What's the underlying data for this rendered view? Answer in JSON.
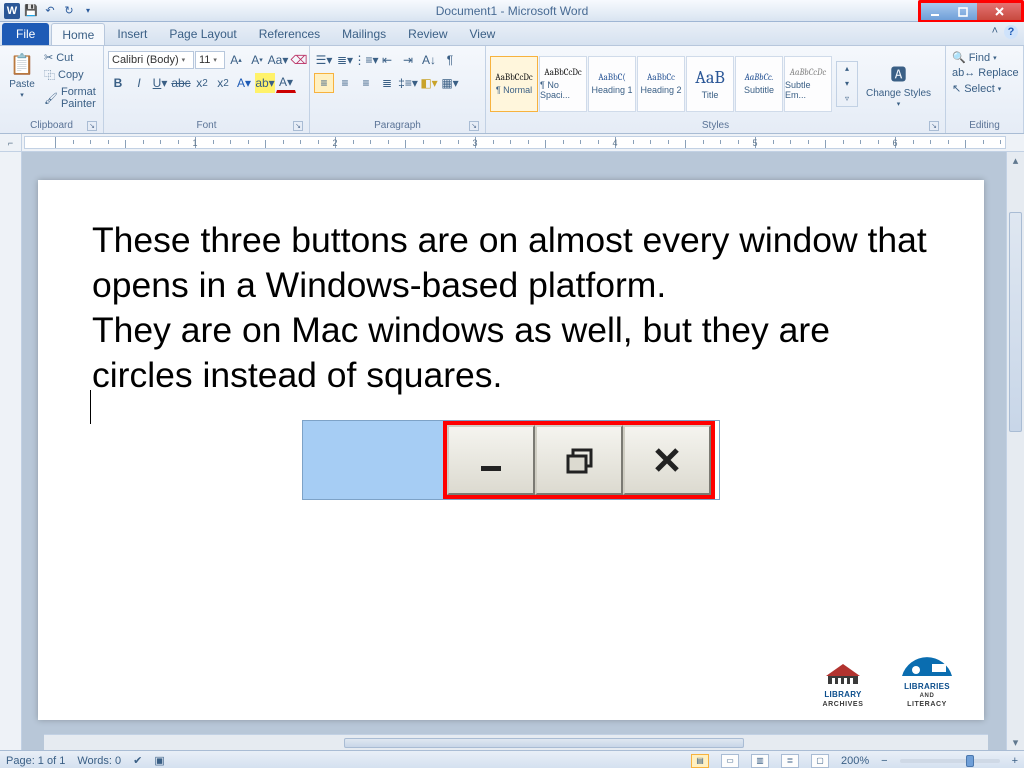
{
  "title": "Document1  -  Microsoft Word",
  "tabs": {
    "file": "File",
    "list": [
      "Home",
      "Insert",
      "Page Layout",
      "References",
      "Mailings",
      "Review",
      "View"
    ],
    "active": 0
  },
  "clipboard": {
    "paste": "Paste",
    "cut": "Cut",
    "copy": "Copy",
    "painter": "Format Painter",
    "label": "Clipboard"
  },
  "font": {
    "family": "Calibri (Body)",
    "size": "11",
    "label": "Font"
  },
  "paragraph": {
    "label": "Paragraph"
  },
  "styles": {
    "label": "Styles",
    "items": [
      {
        "preview": "AaBbCcDc",
        "name": "¶ Normal",
        "sel": true
      },
      {
        "preview": "AaBbCcDc",
        "name": "¶ No Spaci..."
      },
      {
        "preview": "AaBbC(",
        "name": "Heading 1",
        "color": "#2b5797"
      },
      {
        "preview": "AaBbCc",
        "name": "Heading 2",
        "color": "#2b5797"
      },
      {
        "preview": "AaB",
        "name": "Title",
        "color": "#2b5797",
        "big": true
      },
      {
        "preview": "AaBbCc.",
        "name": "Subtitle",
        "color": "#2b5797",
        "italic": true
      },
      {
        "preview": "AaBbCcDc",
        "name": "Subtle Em...",
        "color": "#888",
        "italic": true
      }
    ],
    "change": "Change Styles"
  },
  "editing": {
    "find": "Find",
    "replace": "Replace",
    "select": "Select",
    "label": "Editing"
  },
  "document": {
    "p1": "These three buttons are on almost every window that opens in a Windows-based platform.",
    "p2": "They are on Mac windows as well, but they are circles instead of squares."
  },
  "logos": {
    "a1": "LIBRARY",
    "a2": "ARCHIVES",
    "b1": "LIBRARIES",
    "b2": "LITERACY"
  },
  "status": {
    "page": "Page: 1 of 1",
    "words": "Words: 0",
    "zoom": "200%"
  }
}
